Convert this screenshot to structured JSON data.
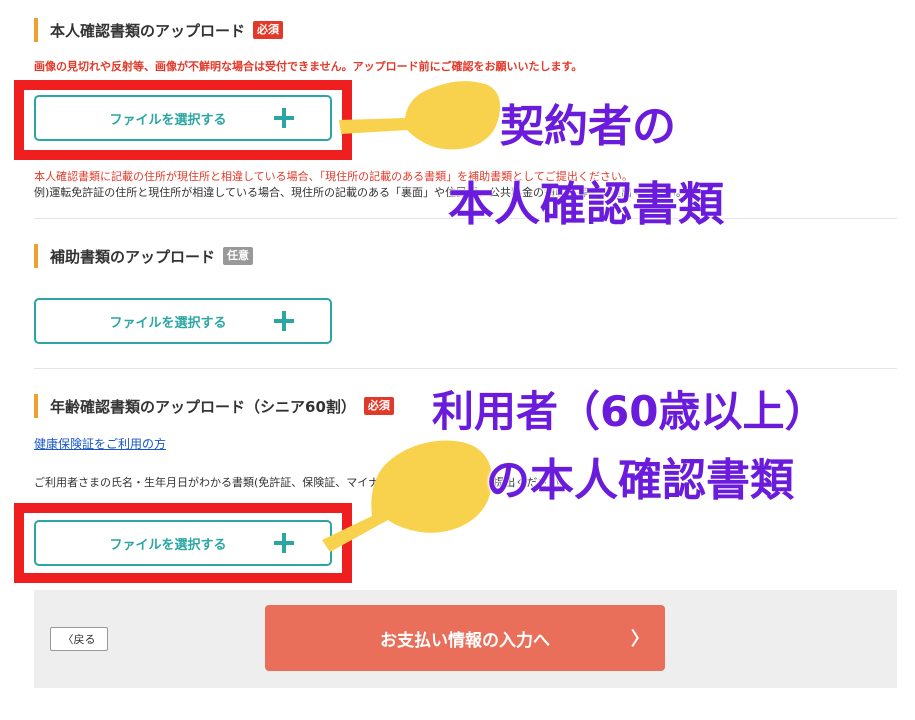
{
  "section1": {
    "title": "本人確認書類のアップロード",
    "badge": "必須",
    "warning": "画像の見切れや反射等、画像が不鮮明な場合は受付できません。アップロード前にご確認をお願いいたします。",
    "button_label": "ファイルを選択する",
    "note_red": "本人確認書類に記載の住所が現住所と相違している場合、「現住所の記載のある書類」を補助書類としてご提出ください。",
    "note": "例)運転免許証の住所と現住所が相違している場合、現住所の記載のある「裏面」や住民票、公共料金の領収書等をご提出ください。"
  },
  "section2": {
    "title": "補助書類のアップロード",
    "badge": "任意",
    "button_label": "ファイルを選択する"
  },
  "section3": {
    "title": "年齢確認書類のアップロード（シニア60割）",
    "badge": "必須",
    "link": "健康保険証をご利用の方",
    "note": "ご利用者さまの氏名・生年月日がわかる書類(免許証、保険証、マイナンバーカードなど)をご提出ください。",
    "button_label": "ファイルを選択する"
  },
  "overlay": {
    "text1_line1": "契約者の",
    "text1_line2": "本人確認書類",
    "text2_line1": "利用者（60歳以上）",
    "text2_line2": "の本人確認書類",
    "text_color": "#6a1bdc",
    "highlight_color": "#f01f1f",
    "hand_color": "#f9d24d"
  },
  "footer": {
    "back_label": "〈戻る",
    "next_label": "お支払い情報の入力へ",
    "next_chevron": "〉"
  },
  "colors": {
    "accent": "#2ba6a3",
    "required": "#e23a2a",
    "next_button": "#ea6f5a"
  }
}
